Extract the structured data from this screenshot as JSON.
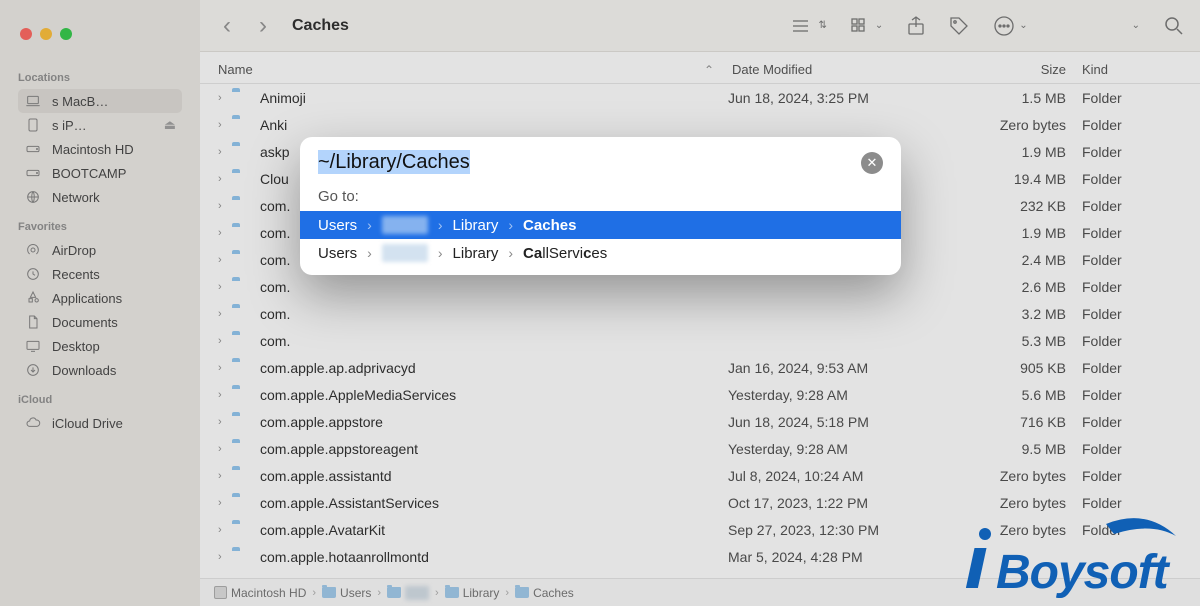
{
  "window_title": "Caches",
  "traffic_lights": {
    "close": "close",
    "minimize": "minimize",
    "zoom": "zoom"
  },
  "sidebar": {
    "sections": [
      {
        "title": "Locations",
        "items": [
          {
            "key": "macbook",
            "label": "s MacB…",
            "icon": "laptop",
            "ejectable": false,
            "selected": true
          },
          {
            "key": "ipad",
            "label": "s iP…",
            "icon": "tablet",
            "ejectable": true
          },
          {
            "key": "macintosh-hd",
            "label": "Macintosh HD",
            "icon": "internal-disk"
          },
          {
            "key": "bootcamp",
            "label": "BOOTCAMP",
            "icon": "internal-disk"
          },
          {
            "key": "network",
            "label": "Network",
            "icon": "globe"
          }
        ]
      },
      {
        "title": "Favorites",
        "items": [
          {
            "key": "airdrop",
            "label": "AirDrop",
            "icon": "airdrop"
          },
          {
            "key": "recents",
            "label": "Recents",
            "icon": "clock"
          },
          {
            "key": "applications",
            "label": "Applications",
            "icon": "apps"
          },
          {
            "key": "documents",
            "label": "Documents",
            "icon": "doc"
          },
          {
            "key": "desktop",
            "label": "Desktop",
            "icon": "desktop"
          },
          {
            "key": "downloads",
            "label": "Downloads",
            "icon": "download"
          }
        ]
      },
      {
        "title": "iCloud",
        "items": [
          {
            "key": "icloud-drive",
            "label": "iCloud Drive",
            "icon": "cloud"
          }
        ]
      }
    ]
  },
  "toolbar": {
    "view_mode": "list",
    "icons": [
      "view-list",
      "view-grid",
      "share",
      "tag",
      "more",
      "dropdown",
      "search"
    ]
  },
  "columns": {
    "name": "Name",
    "date": "Date Modified",
    "size": "Size",
    "kind": "Kind"
  },
  "files": [
    {
      "name": "Animoji",
      "date": "Jun 18, 2024, 3:25 PM",
      "size": "1.5 MB",
      "kind": "Folder"
    },
    {
      "name": "Anki",
      "date": "",
      "size": "Zero bytes",
      "kind": "Folder"
    },
    {
      "name": "askp",
      "date": "",
      "size": "1.9 MB",
      "kind": "Folder"
    },
    {
      "name": "Clou",
      "date": "",
      "size": "19.4 MB",
      "kind": "Folder"
    },
    {
      "name": "com.",
      "date": "",
      "size": "232 KB",
      "kind": "Folder"
    },
    {
      "name": "com.",
      "date": "",
      "size": "1.9 MB",
      "kind": "Folder"
    },
    {
      "name": "com.",
      "date": "",
      "size": "2.4 MB",
      "kind": "Folder"
    },
    {
      "name": "com.",
      "date": "",
      "size": "2.6 MB",
      "kind": "Folder"
    },
    {
      "name": "com.",
      "date": "",
      "size": "3.2 MB",
      "kind": "Folder"
    },
    {
      "name": "com.",
      "date": "",
      "size": "5.3 MB",
      "kind": "Folder"
    },
    {
      "name": "com.apple.ap.adprivacyd",
      "date": "Jan 16, 2024, 9:53 AM",
      "size": "905 KB",
      "kind": "Folder"
    },
    {
      "name": "com.apple.AppleMediaServices",
      "date": "Yesterday, 9:28 AM",
      "size": "5.6 MB",
      "kind": "Folder"
    },
    {
      "name": "com.apple.appstore",
      "date": "Jun 18, 2024, 5:18 PM",
      "size": "716 KB",
      "kind": "Folder"
    },
    {
      "name": "com.apple.appstoreagent",
      "date": "Yesterday, 9:28 AM",
      "size": "9.5 MB",
      "kind": "Folder"
    },
    {
      "name": "com.apple.assistantd",
      "date": "Jul 8, 2024, 10:24 AM",
      "size": "Zero bytes",
      "kind": "Folder"
    },
    {
      "name": "com.apple.AssistantServices",
      "date": "Oct 17, 2023, 1:22 PM",
      "size": "Zero bytes",
      "kind": "Folder"
    },
    {
      "name": "com.apple.AvatarKit",
      "date": "Sep 27, 2023, 12:30 PM",
      "size": "Zero bytes",
      "kind": "Folder"
    },
    {
      "name": "com.apple.hotaanrollmontd",
      "date": "Mar 5, 2024, 4:28 PM",
      "size": "",
      "kind": ""
    }
  ],
  "pathbar": [
    {
      "label": "Macintosh HD",
      "icon": "disk"
    },
    {
      "label": "Users",
      "icon": "folder"
    },
    {
      "label": "",
      "icon": "folder",
      "blur": true
    },
    {
      "label": "Library",
      "icon": "folder"
    },
    {
      "label": "Caches",
      "icon": "folder"
    }
  ],
  "goto": {
    "input_value": "~/Library/Caches",
    "label": "Go to:",
    "results": [
      {
        "segments": [
          "Users",
          "(user)",
          "Library",
          "Caches"
        ],
        "bold_last": true,
        "selected": true
      },
      {
        "segments": [
          "Users",
          "(user)",
          "Library",
          "CallServices"
        ],
        "bold_letters": [
          "Ca",
          "c"
        ],
        "selected": false
      }
    ]
  },
  "watermark": "iBoysoft"
}
